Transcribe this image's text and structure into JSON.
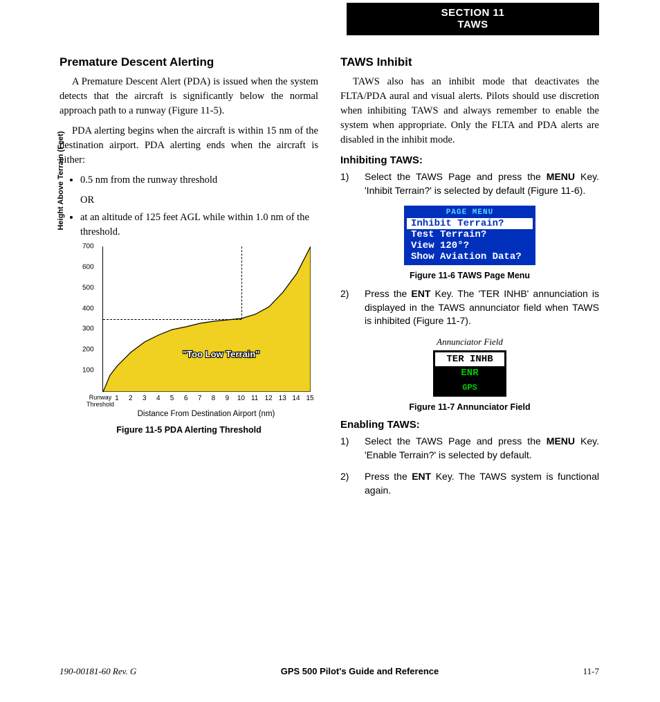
{
  "section_header": {
    "line1": "SECTION 11",
    "line2": "TAWS"
  },
  "left": {
    "h2": "Premature Descent Alerting",
    "p1": "A Premature Descent Alert (PDA) is issued when the system detects that the aircraft is significantly below the normal approach path to a runway (Figure 11-5).",
    "p2": "PDA alerting begins when the aircraft is within 15 nm of the destination airport. PDA alerting ends when the aircraft is either:",
    "b1": "0.5 nm from the runway threshold",
    "or": "OR",
    "b2": " at an altitude of 125 feet AGL while within 1.0 nm of the threshold.",
    "chart_caption": "Figure 11-5  PDA Alerting Threshold"
  },
  "right": {
    "h2": "TAWS Inhibit",
    "p1": "TAWS also has an inhibit mode that deactivates the FLTA/PDA aural and visual alerts.  Pilots should use discretion when inhibiting TAWS and always remember to enable the system when appropriate.  Only the FLTA and PDA alerts are disabled in the inhibit mode.",
    "h3a": "Inhibiting TAWS:",
    "s1a_pre": "Select the TAWS Page and press the ",
    "s1a_bold": "MENU",
    "s1a_post": " Key. 'Inhibit Terrain?' is selected by default (Figure 11-6).",
    "menu": {
      "title": "PAGE MENU",
      "items": [
        "Inhibit Terrain?",
        "Test Terrain?",
        "View 120°?",
        "Show Aviation Data?"
      ]
    },
    "fig6": "Figure 11-6  TAWS Page Menu",
    "s2a_pre": "Press the ",
    "s2a_bold": "ENT",
    "s2a_post": " Key.  The 'TER INHB' annunciation is displayed in the TAWS annunciator field when TAWS is inhibited (Figure 11-7).",
    "annun_label": "Annunciator Field",
    "annun": {
      "r1": "TER INHB",
      "r2": "ENR",
      "r3": "GPS"
    },
    "fig7": "Figure 11-7  Annunciator Field",
    "h3b": "Enabling TAWS:",
    "s1b_pre": "Select the TAWS Page and press the ",
    "s1b_bold": "MENU",
    "s1b_post": " Key.  'Enable Terrain?' is selected by default.",
    "s2b_pre": "Press the ",
    "s2b_bold": "ENT",
    "s2b_post": " Key.  The TAWS system is functional again."
  },
  "footer": {
    "l": "190-00181-60  Rev. G",
    "c": "GPS 500 Pilot's Guide and Reference",
    "r": "11-7"
  },
  "chart_data": {
    "type": "area",
    "title": "PDA Alerting Threshold",
    "xlabel": "Distance From Destination Airport (nm)",
    "ylabel": "Height Above Terrain (Feet)",
    "xlim": [
      0,
      15
    ],
    "ylim": [
      0,
      700
    ],
    "x_ticks": [
      1,
      2,
      3,
      4,
      5,
      6,
      7,
      8,
      9,
      10,
      11,
      12,
      13,
      14,
      15
    ],
    "y_ticks": [
      100,
      200,
      300,
      400,
      500,
      600,
      700
    ],
    "x_origin_label": "Runway Threshold",
    "annotation": "\"Too Low Terrain\"",
    "reference_lines": [
      {
        "axis": "y",
        "value": 350,
        "style": "dashed"
      },
      {
        "axis": "x",
        "value": 10,
        "style": "dashed"
      }
    ],
    "series": [
      {
        "name": "PDA threshold curve",
        "x": [
          0,
          0.5,
          1,
          2,
          3,
          4,
          5,
          6,
          7,
          8,
          9,
          10,
          11,
          12,
          13,
          14,
          15
        ],
        "values": [
          0,
          80,
          125,
          190,
          240,
          275,
          300,
          315,
          330,
          340,
          348,
          355,
          375,
          410,
          480,
          570,
          700
        ]
      }
    ]
  }
}
